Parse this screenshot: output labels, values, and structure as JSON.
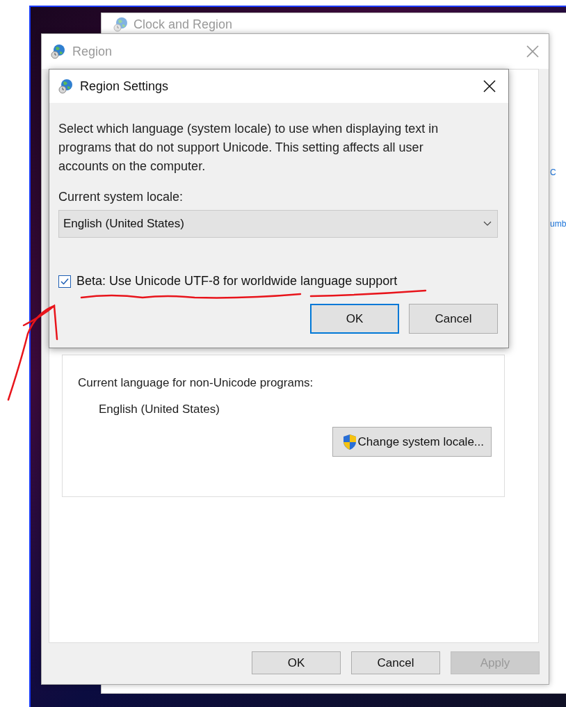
{
  "background_window": {
    "title": "Clock and Region",
    "links": [
      "C",
      "umb"
    ]
  },
  "region_window": {
    "title": "Region",
    "active": false,
    "group": {
      "label": "Current language for non-Unicode programs:",
      "value": "English (United States)",
      "button": "Change system locale..."
    },
    "buttons": [
      {
        "label": "OK",
        "disabled": false
      },
      {
        "label": "Cancel",
        "disabled": false
      },
      {
        "label": "Apply",
        "disabled": true
      }
    ]
  },
  "dialog": {
    "title": "Region Settings",
    "active": true,
    "description": "Select which language (system locale) to use when displaying text in programs that do not support Unicode. This setting affects all user accounts on the computer.",
    "locale_label": "Current system locale:",
    "locale_select": {
      "value": "English (United States)"
    },
    "utf8_checkbox": {
      "label": "Beta: Use Unicode UTF-8 for worldwide language support",
      "checked": true
    },
    "buttons": [
      {
        "label": "OK",
        "default": true
      },
      {
        "label": "Cancel",
        "default": false
      }
    ]
  }
}
